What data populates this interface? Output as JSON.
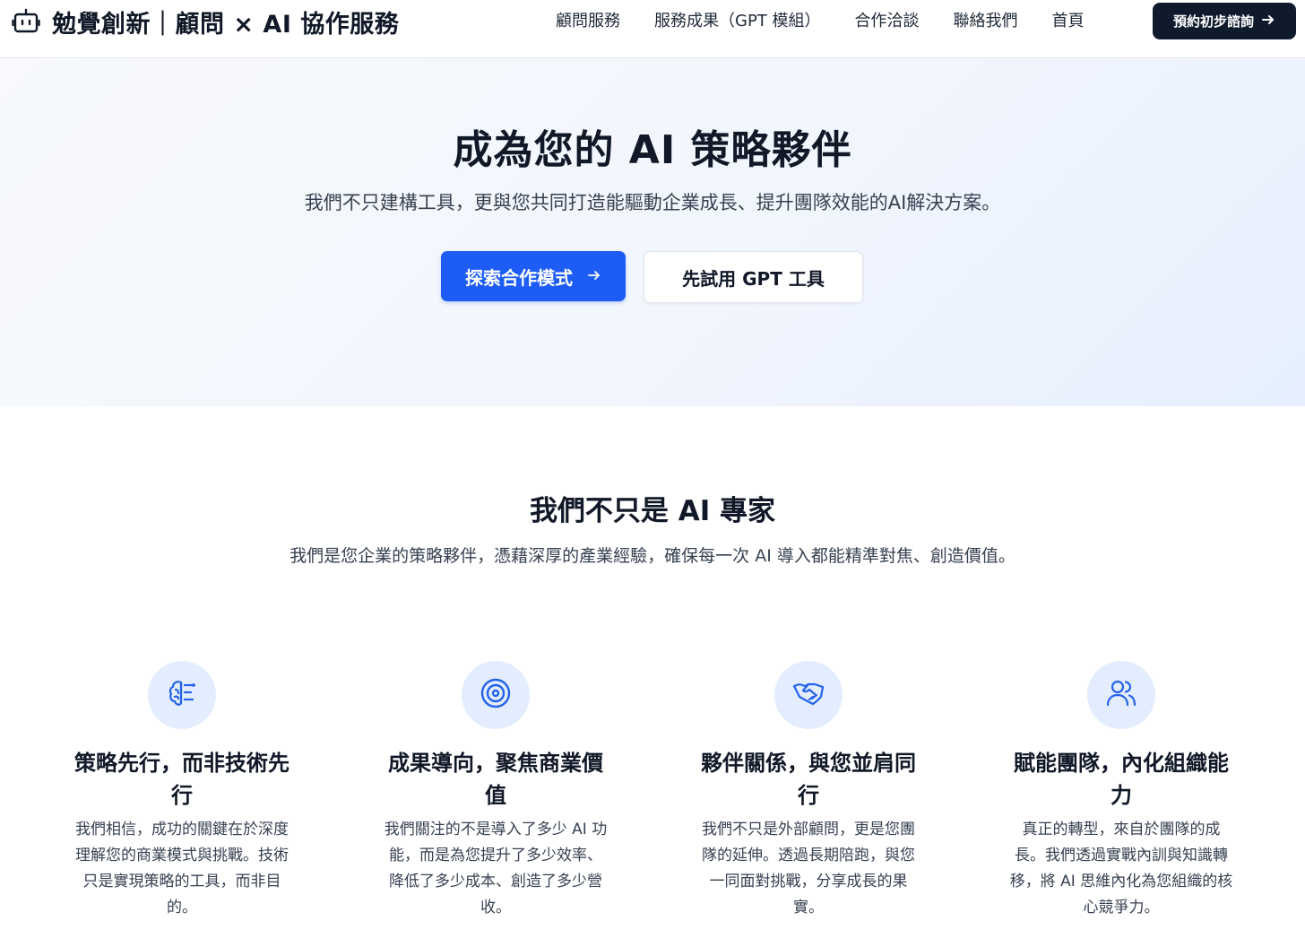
{
  "header": {
    "brand": "勉覺創新｜顧問 × AI 協作服務",
    "brand_icon": "robot-icon",
    "nav": [
      {
        "label": "顧問服務"
      },
      {
        "label": "服務成果（GPT 模組）"
      },
      {
        "label": "合作洽談"
      },
      {
        "label": "聯絡我們"
      },
      {
        "label": "首頁"
      }
    ],
    "cta_label": "預約初步諮詢",
    "cta_icon": "arrow-right-icon"
  },
  "hero": {
    "title": "成為您的 AI 策略夥伴",
    "subtitle": "我們不只建構工具，更與您共同打造能驅動企業成長、提升團隊效能的AI解決方案。",
    "primary_button": "探索合作模式",
    "primary_button_icon": "arrow-right-icon",
    "secondary_button": "先試用 GPT 工具"
  },
  "about": {
    "title": "我們不只是 AI 專家",
    "subtitle": "我們是您企業的策略夥伴，憑藉深厚的產業經驗，確保每一次 AI 導入都能精準對焦、創造價值。"
  },
  "features": [
    {
      "icon": "brain-icon",
      "title": "策略先行，而非技術先行",
      "desc": "我們相信，成功的關鍵在於深度理解您的商業模式與挑戰。技術只是實現策略的工具，而非目的。"
    },
    {
      "icon": "target-icon",
      "title": "成果導向，聚焦商業價值",
      "desc": "我們關注的不是導入了多少 AI 功能，而是為您提升了多少效率、降低了多少成本、創造了多少營收。"
    },
    {
      "icon": "handshake-icon",
      "title": "夥伴關係，與您並肩同行",
      "desc": "我們不只是外部顧問，更是您團隊的延伸。透過長期陪跑，與您一同面對挑戰，分享成長的果實。"
    },
    {
      "icon": "users-icon",
      "title": "賦能團隊，內化組織能力",
      "desc": "真正的轉型，來自於團隊的成長。我們透過實戰內訓與知識轉移，將 AI 思維內化為您組織的核心競爭力。"
    }
  ],
  "colors": {
    "primary": "#1d5df5",
    "dark_button": "#0f1b2d",
    "icon_bg": "#e3edfd",
    "icon_stroke": "#2563eb"
  }
}
